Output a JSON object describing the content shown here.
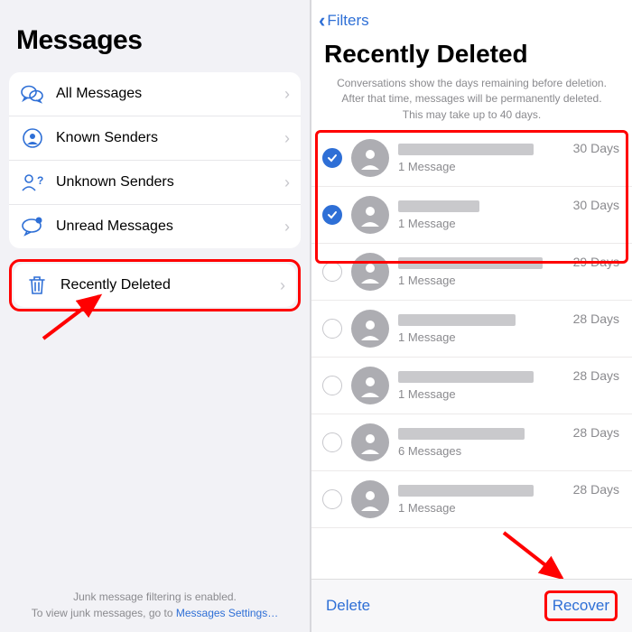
{
  "left": {
    "title": "Messages",
    "filters": [
      {
        "icon": "bubbles",
        "label": "All Messages"
      },
      {
        "icon": "known",
        "label": "Known Senders"
      },
      {
        "icon": "unknown",
        "label": "Unknown Senders"
      },
      {
        "icon": "unread",
        "label": "Unread Messages"
      }
    ],
    "trash": {
      "label": "Recently Deleted"
    },
    "footer1": "Junk message filtering is enabled.",
    "footer2a": "To view junk messages, go to ",
    "footer2b": "Messages Settings…"
  },
  "right": {
    "back": "Filters",
    "title": "Recently Deleted",
    "notice": "Conversations show the days remaining before deletion. After that time, messages will be permanently deleted. This may take up to 40 days.",
    "convs": [
      {
        "selected": true,
        "nameW": 150,
        "count": "1 Message",
        "days": "30 Days"
      },
      {
        "selected": true,
        "nameW": 90,
        "count": "1 Message",
        "days": "30 Days"
      },
      {
        "selected": false,
        "nameW": 160,
        "count": "1 Message",
        "days": "29 Days"
      },
      {
        "selected": false,
        "nameW": 130,
        "count": "1 Message",
        "days": "28 Days"
      },
      {
        "selected": false,
        "nameW": 150,
        "count": "1 Message",
        "days": "28 Days"
      },
      {
        "selected": false,
        "nameW": 140,
        "count": "6 Messages",
        "days": "28 Days"
      },
      {
        "selected": false,
        "nameW": 150,
        "count": "1 Message",
        "days": "28 Days"
      }
    ],
    "delete": "Delete",
    "recover": "Recover"
  }
}
